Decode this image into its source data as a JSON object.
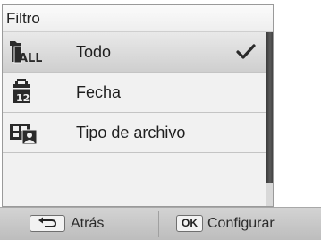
{
  "panel": {
    "title": "Filtro"
  },
  "items": [
    {
      "label": "Todo",
      "icon": "all-files-icon",
      "icon_text": "ALL",
      "selected": true
    },
    {
      "label": "Fecha",
      "icon": "calendar-icon",
      "icon_text": "12",
      "selected": false
    },
    {
      "label": "Tipo de archivo",
      "icon": "file-type-icon",
      "selected": false
    }
  ],
  "bottom_bar": {
    "back_label": "Atrás",
    "back_icon": "back-arrow-icon",
    "ok_key_label": "OK",
    "configure_label": "Configurar"
  },
  "colors": {
    "selected_row": "#d9d9d9",
    "scroll_thumb": "#444444",
    "panel_bg": "#f1f1f1"
  }
}
